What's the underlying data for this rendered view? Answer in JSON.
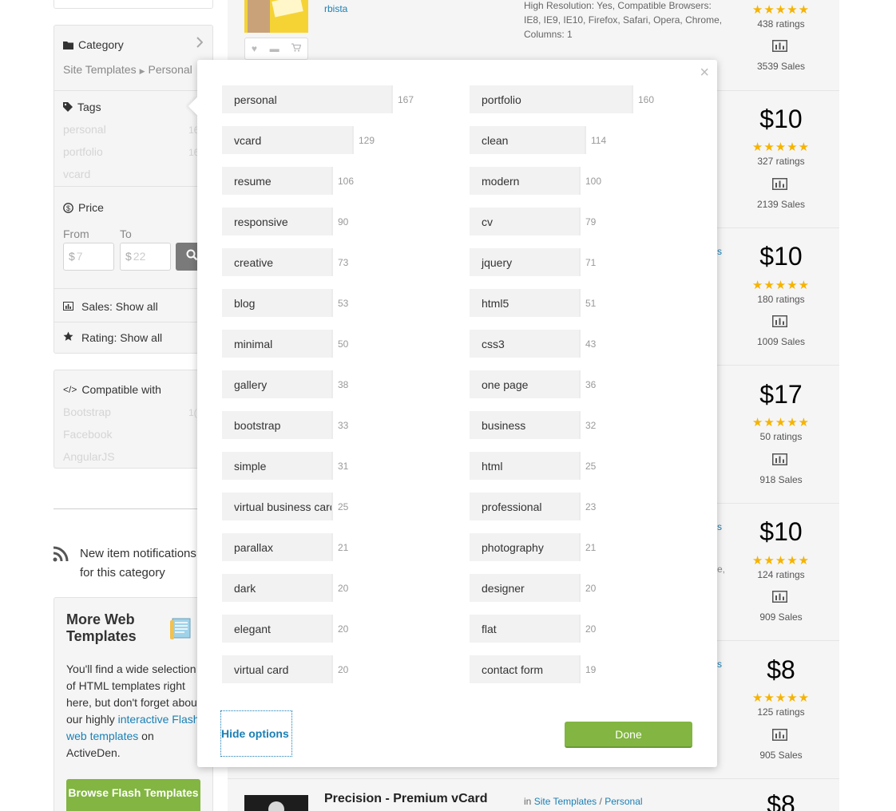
{
  "sidebar": {
    "category": {
      "title": "Category",
      "breadcrumb": [
        "Site Templates",
        "Personal"
      ]
    },
    "tags": {
      "title": "Tags",
      "items": [
        {
          "label": "personal",
          "count": "16"
        },
        {
          "label": "portfolio",
          "count": "16"
        },
        {
          "label": "vcard",
          "count": ""
        }
      ]
    },
    "price": {
      "title": "Price",
      "from_label": "From",
      "to_label": "To",
      "currency": "$",
      "from_placeholder": "7",
      "to_placeholder": "22"
    },
    "sales_filter": "Sales: Show all",
    "rating_filter": "Rating: Show all",
    "compatible": {
      "title": "Compatible with",
      "items": [
        {
          "label": "Bootstrap",
          "count": "1("
        },
        {
          "label": "Facebook",
          "count": ""
        },
        {
          "label": "AngularJS",
          "count": ""
        }
      ]
    },
    "notification": "New item notifications for this category",
    "more": {
      "title": "More Web Templates",
      "text_before": "You'll find a wide selection of HTML templates right here, but don't forget about our highly ",
      "link_text": "interactive Flash web templates",
      "text_after": " on ActiveDen.",
      "button": "Browse Flash Templates"
    }
  },
  "listing": {
    "first_item": {
      "author": "rbista",
      "specs": "High Resolution: Yes, Compatible Browsers: IE8, IE9, IE10, Firefox, Safari, Opera, Chrome, Columns: 1"
    },
    "items": [
      {
        "price": "",
        "ratings": "438 ratings",
        "sales": "3539 Sales",
        "stars": "★★★★★"
      },
      {
        "price": "$10",
        "ratings": "327 ratings",
        "sales": "2139 Sales",
        "stars": "★★★★★"
      },
      {
        "price": "$10",
        "ratings": "180 ratings",
        "sales": "1009 Sales",
        "stars": "★★★★★"
      },
      {
        "price": "$17",
        "ratings": "50 ratings",
        "sales": "918 Sales",
        "stars": "★★★★★"
      },
      {
        "price": "$10",
        "ratings": "124 ratings",
        "sales": "909 Sales",
        "stars": "★★★★★"
      },
      {
        "price": "$8",
        "ratings": "125 ratings",
        "sales": "905 Sales",
        "stars": "★★★★★"
      }
    ],
    "bottom_item": {
      "title": "Precision - Premium vCard",
      "in_label": "in",
      "category": "Site Templates",
      "subcategory": "Personal",
      "price": "$8"
    },
    "stray_fragments": [
      "s",
      "s",
      "s",
      "e,",
      "s"
    ]
  },
  "tag_modal": {
    "left_column": [
      {
        "label": "personal",
        "count": "167"
      },
      {
        "label": "vcard",
        "count": "129"
      },
      {
        "label": "resume",
        "count": "106"
      },
      {
        "label": "responsive",
        "count": "90"
      },
      {
        "label": "creative",
        "count": "73"
      },
      {
        "label": "blog",
        "count": "53"
      },
      {
        "label": "minimal",
        "count": "50"
      },
      {
        "label": "gallery",
        "count": "38"
      },
      {
        "label": "bootstrap",
        "count": "33"
      },
      {
        "label": "simple",
        "count": "31"
      },
      {
        "label": "virtual business card",
        "count": "25"
      },
      {
        "label": "parallax",
        "count": "21"
      },
      {
        "label": "dark",
        "count": "20"
      },
      {
        "label": "elegant",
        "count": "20"
      },
      {
        "label": "virtual card",
        "count": "20"
      }
    ],
    "right_column": [
      {
        "label": "portfolio",
        "count": "160"
      },
      {
        "label": "clean",
        "count": "114"
      },
      {
        "label": "modern",
        "count": "100"
      },
      {
        "label": "cv",
        "count": "79"
      },
      {
        "label": "jquery",
        "count": "71"
      },
      {
        "label": "html5",
        "count": "51"
      },
      {
        "label": "css3",
        "count": "43"
      },
      {
        "label": "one page",
        "count": "36"
      },
      {
        "label": "business",
        "count": "32"
      },
      {
        "label": "html",
        "count": "25"
      },
      {
        "label": "professional",
        "count": "23"
      },
      {
        "label": "photography",
        "count": "21"
      },
      {
        "label": "designer",
        "count": "20"
      },
      {
        "label": "flat",
        "count": "20"
      },
      {
        "label": "contact form",
        "count": "19"
      }
    ],
    "close_label": "×",
    "hide_options": "Hide options",
    "done": "Done"
  },
  "colors": {
    "accent_green": "#82b541",
    "link_blue": "#1a7fb4",
    "star_yellow": "#f5b301"
  }
}
